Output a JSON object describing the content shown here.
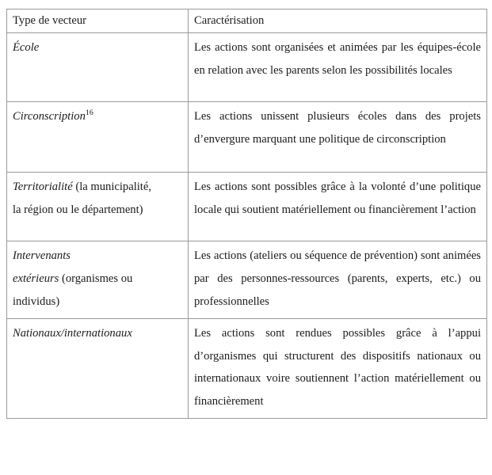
{
  "table": {
    "name": "tableau-type-de-vecteur",
    "columns": [
      {
        "id": "type",
        "header": "Type de vecteur"
      },
      {
        "id": "caracterisation",
        "header": "Caractérisation"
      }
    ],
    "rows": [
      {
        "id": "ecole",
        "type_italic": "École",
        "type_roman": "",
        "type_footnote": "",
        "type_line2": "",
        "type_line3": "",
        "caracterisation": "Les actions sont organisées et animées par les équipes-école en relation avec les parents selon les possibilités locales"
      },
      {
        "id": "circonscription",
        "type_italic": "Circonscription",
        "type_roman": "",
        "type_footnote": "16",
        "type_line2": "",
        "type_line3": "",
        "caracterisation": "Les actions unissent plusieurs écoles dans des projets d’envergure marquant une politique de circonscription"
      },
      {
        "id": "territorialite",
        "type_italic": "Territorialité",
        "type_roman": " (la municipalité,",
        "type_footnote": "",
        "type_line2": "la région ou le département)",
        "type_line3": "",
        "caracterisation": "Les actions sont possibles grâce à la volonté d’une politique locale qui soutient matériellement ou financièrement l’action"
      },
      {
        "id": "intervenants-exterieurs",
        "type_italic": "Intervenants",
        "type_roman": "",
        "type_footnote": "",
        "type_line2_italic": "extérieurs",
        "type_line2_roman": " (organismes ou",
        "type_line3": "individus)",
        "caracterisation": "Les actions (ateliers ou séquence de prévention) sont animées par des personnes-ressources (parents, experts, etc.) ou professionnelles"
      },
      {
        "id": "nationaux-internationaux",
        "type_italic": "Nationaux/internationaux",
        "type_roman": "",
        "type_footnote": "",
        "type_line2": "",
        "type_line3": "",
        "caracterisation": "Les actions sont rendues possibles grâce à l’appui d’organismes qui structurent des dispositifs nationaux ou internationaux voire soutiennent l’action matériellement ou financièrement"
      }
    ]
  },
  "style": {
    "border_color": "#9a9a9a",
    "text_color": "#1a1a1a",
    "background": "#ffffff"
  }
}
